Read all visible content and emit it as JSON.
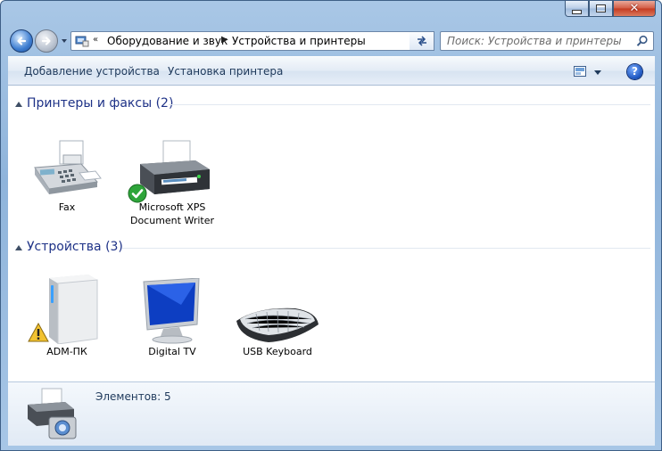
{
  "window": {
    "controls": {
      "minimize_icon": "minimize-icon",
      "maximize_icon": "maximize-icon",
      "close_icon": "close-icon"
    }
  },
  "nav": {
    "back_icon": "back-arrow-icon",
    "forward_icon": "forward-arrow-icon",
    "breadcrumb_overflow": "«",
    "breadcrumb": [
      "Оборудование и звук",
      "Устройства и принтеры"
    ],
    "refresh_icon": "refresh-icon",
    "search_placeholder": "Поиск: Устройства и принтеры"
  },
  "toolbar": {
    "add_device": "Добавление устройства",
    "add_printer": "Установка принтера",
    "view_icon": "change-view-icon",
    "help_label": "?"
  },
  "groups": [
    {
      "title": "Принтеры и факсы (2)",
      "items": [
        {
          "label": "Fax",
          "icon": "fax-icon"
        },
        {
          "label_line1": "Microsoft XPS",
          "label_line2": "Document Writer",
          "icon": "printer-icon",
          "badge": "default-check-icon"
        }
      ]
    },
    {
      "title": "Устройства (3)",
      "items": [
        {
          "label": "ADM-ПК",
          "icon": "computer-tower-icon",
          "badge": "warning-icon"
        },
        {
          "label": "Digital TV",
          "icon": "monitor-icon"
        },
        {
          "label": "USB Keyboard",
          "icon": "keyboard-icon"
        }
      ]
    }
  ],
  "details": {
    "count_text": "Элементов: 5",
    "icon": "devices-and-printers-icon"
  },
  "colors": {
    "group_title": "#1e3287",
    "command_text": "#1e395b",
    "frame": "#a9c7e6"
  }
}
